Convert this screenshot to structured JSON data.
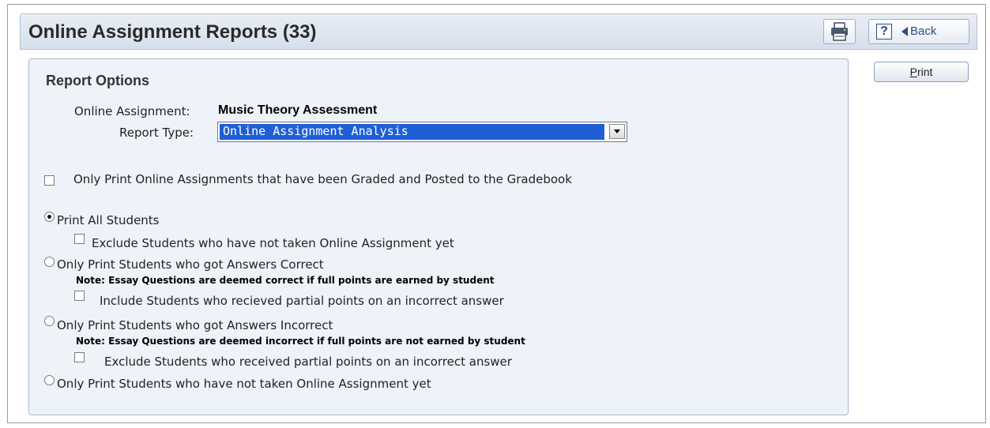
{
  "header": {
    "title": "Online Assignment Reports (33)",
    "help_label": "?",
    "back_label": "Back"
  },
  "actions": {
    "print_label": "Print"
  },
  "options": {
    "section_title": "Report Options",
    "assignment_label": "Online Assignment:",
    "assignment_value": "Music Theory Assessment",
    "report_type_label": "Report Type:",
    "report_type_value": "Online Assignment Analysis",
    "only_graded_label": "Only Print Online Assignments that have been Graded and Posted to the Gradebook",
    "print_all_label": "Print All Students",
    "exclude_not_taken_label": "Exclude Students who have not taken Online Assignment yet",
    "correct_label": "Only Print Students who got Answers Correct",
    "correct_note": "Note: Essay Questions are deemed correct if full points are earned by student",
    "include_partial_label": "Include Students who recieved partial points on an incorrect answer",
    "incorrect_label": "Only Print Students who got Answers Incorrect",
    "incorrect_note": "Note: Essay Questions are deemed incorrect if full points are not earned by student",
    "exclude_partial_label": "Exclude Students who received partial points on an incorrect answer",
    "not_taken_label": "Only Print Students who have not taken Online Assignment yet"
  },
  "state": {
    "only_graded_checked": false,
    "selected_radio": "print_all",
    "exclude_not_taken_checked": false,
    "include_partial_checked": false,
    "exclude_partial_checked": false
  },
  "colors": {
    "header_bg": "#dde6f0",
    "panel_bg": "#eef3f9",
    "select_highlight": "#1f5fd6",
    "accent": "#2b4f86"
  },
  "icons": {
    "print_tool": "printer-icon",
    "help": "help-icon",
    "back": "back-arrow-icon"
  }
}
